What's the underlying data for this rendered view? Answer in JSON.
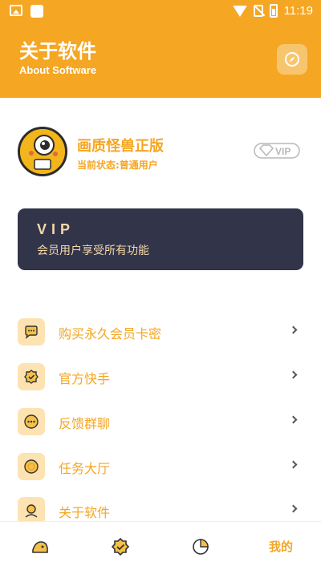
{
  "status_bar": {
    "time": "11:19"
  },
  "header": {
    "title": "关于软件",
    "subtitle": "About Software"
  },
  "profile": {
    "app_name": "画质怪兽正版",
    "status": "当前状态:普通用户",
    "badge": "VIP"
  },
  "vip_card": {
    "title": "VIP",
    "description": "会员用户享受所有功能"
  },
  "menu": [
    {
      "label": "购买永久会员卡密",
      "icon": "chat-bubble-icon"
    },
    {
      "label": "官方快手",
      "icon": "badge-check-icon"
    },
    {
      "label": "反馈群聊",
      "icon": "more-dots-icon"
    },
    {
      "label": "任务大厅",
      "icon": "circle-icon"
    },
    {
      "label": "关于软件",
      "icon": "user-icon"
    }
  ],
  "tabbar": {
    "mine_label": "我的"
  },
  "colors": {
    "accent": "#f5a623",
    "card_bg": "#32344a",
    "card_text": "#f3d9a8",
    "icon_bg": "#fde3b2"
  }
}
